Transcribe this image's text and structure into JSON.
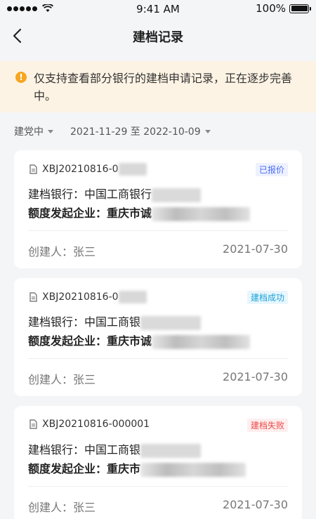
{
  "status_bar": {
    "time": "9:41 AM",
    "battery": "100%"
  },
  "nav": {
    "title": "建档记录",
    "back_icon": "chevron-left-icon"
  },
  "notice": {
    "icon": "!",
    "text": "仅支持查看部分银行的建档申请记录，正在逐步完善中。"
  },
  "filters": {
    "status": "建党中",
    "date_range": "2021-11-29 至 2022-10-09"
  },
  "records": [
    {
      "code": "XBJ20210816-0",
      "status": "已报价",
      "status_color": "#4a6cf7",
      "status_bg": "#eef1ff",
      "bank_label": "建档银行：",
      "bank": "中国工商银行",
      "ent_label": "额度发起企业：",
      "enterprise": "重庆市诚",
      "creator": "创建人：张三",
      "date": "2021-07-30"
    },
    {
      "code": "XBJ20210816-0",
      "status": "建档成功",
      "status_color": "#1aa3d9",
      "status_bg": "#e8f6fd",
      "bank_label": "建档银行：",
      "bank": "中国工商银",
      "ent_label": "额度发起企业：",
      "enterprise": "重庆市诚",
      "creator": "创建人：张三",
      "date": "2021-07-30"
    },
    {
      "code": "XBJ20210816-000001",
      "status": "建档失败",
      "status_color": "#f04848",
      "status_bg": "#feeeee",
      "bank_label": "建档银行：",
      "bank": "中国工商银",
      "ent_label": "额度发起企业：",
      "enterprise": "重庆市",
      "creator": "创建人：张三",
      "date": "2021-07-30"
    }
  ]
}
